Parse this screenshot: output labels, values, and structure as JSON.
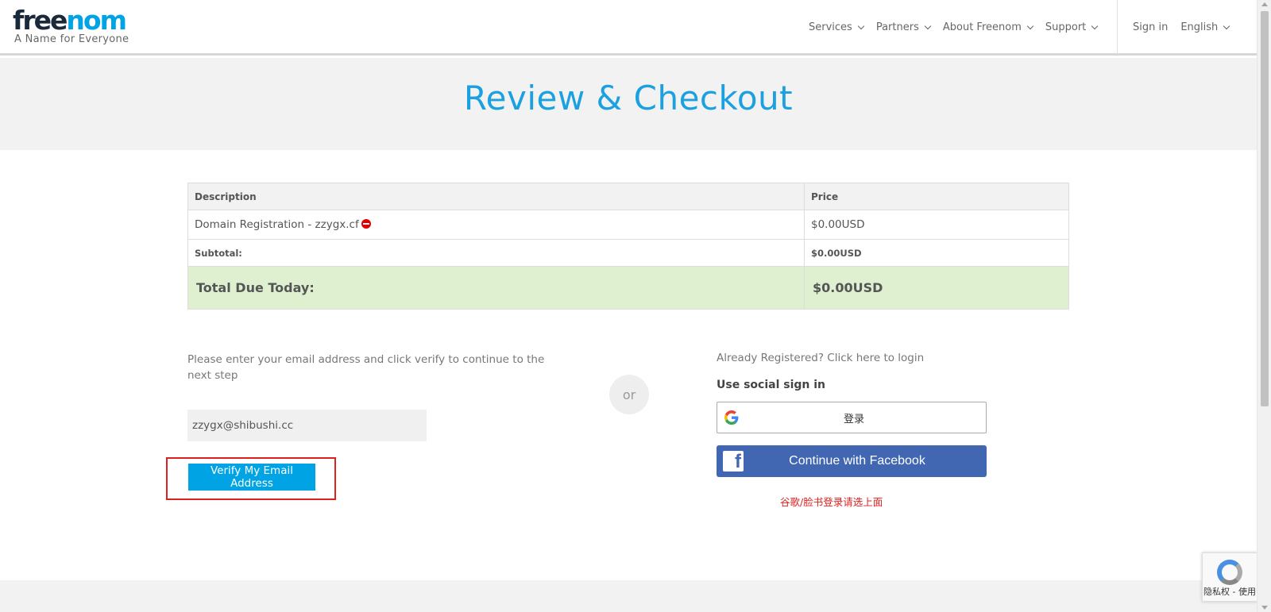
{
  "header": {
    "logo_free": "free",
    "logo_nom": "nom",
    "tagline": "A Name for Everyone",
    "nav": [
      {
        "label": "Services"
      },
      {
        "label": "Partners"
      },
      {
        "label": "About Freenom"
      },
      {
        "label": "Support"
      }
    ],
    "sign_in": "Sign in",
    "language": "English"
  },
  "page": {
    "title": "Review & Checkout"
  },
  "cart": {
    "headers": {
      "description": "Description",
      "price": "Price"
    },
    "item": {
      "description": "Domain Registration - zzygx.cf",
      "price": "$0.00USD"
    },
    "subtotal": {
      "label": "Subtotal:",
      "value": "$0.00USD"
    },
    "total": {
      "label": "Total Due Today:",
      "value": "$0.00USD"
    }
  },
  "verify": {
    "help_text": "Please enter your email address and click verify to continue to the next step",
    "email_value": "zzygx@shibushi.cc",
    "button_label": "Verify My Email Address"
  },
  "or_label": "or",
  "login": {
    "already_registered": "Already Registered? Click here to login",
    "social_label": "Use social sign in",
    "google_label": "登录",
    "facebook_label": "Continue with Facebook",
    "note": "谷歌/脸书登录请选上面"
  },
  "recaptcha": {
    "text": "隐私权 - 使用"
  },
  "colors": {
    "brand_blue": "#00a4e4",
    "facebook_blue": "#4267b2",
    "total_green": "#dff0d0",
    "alert_red": "#e02020"
  }
}
